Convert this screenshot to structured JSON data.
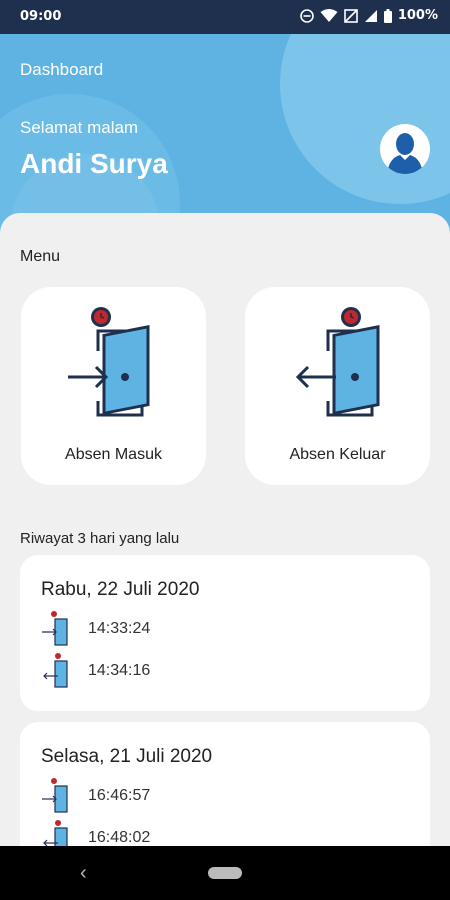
{
  "status_bar": {
    "time": "09:00",
    "battery": "100%"
  },
  "header": {
    "title": "Dashboard",
    "greeting": "Selamat malam",
    "username": "Andi Surya"
  },
  "menu": {
    "label": "Menu",
    "items": [
      {
        "label": "Absen Masuk",
        "icon": "door-enter-icon"
      },
      {
        "label": "Absen Keluar",
        "icon": "door-exit-icon"
      }
    ]
  },
  "history": {
    "label": "Riwayat 3 hari yang lalu",
    "days": [
      {
        "date": "Rabu, 22 Juli 2020",
        "entries": [
          {
            "type": "masuk",
            "time": "14:33:24"
          },
          {
            "type": "keluar",
            "time": "14:34:16"
          }
        ]
      },
      {
        "date": "Selasa, 21 Juli 2020",
        "entries": [
          {
            "type": "masuk",
            "time": "16:46:57"
          },
          {
            "type": "keluar",
            "time": "16:48:02"
          }
        ]
      }
    ]
  },
  "colors": {
    "header_bg": "#5fb3e3",
    "status_bg": "#1f2f4e",
    "door_blue": "#5fb3e3",
    "door_navy": "#1f2f4e",
    "clock_red": "#c0282d"
  }
}
